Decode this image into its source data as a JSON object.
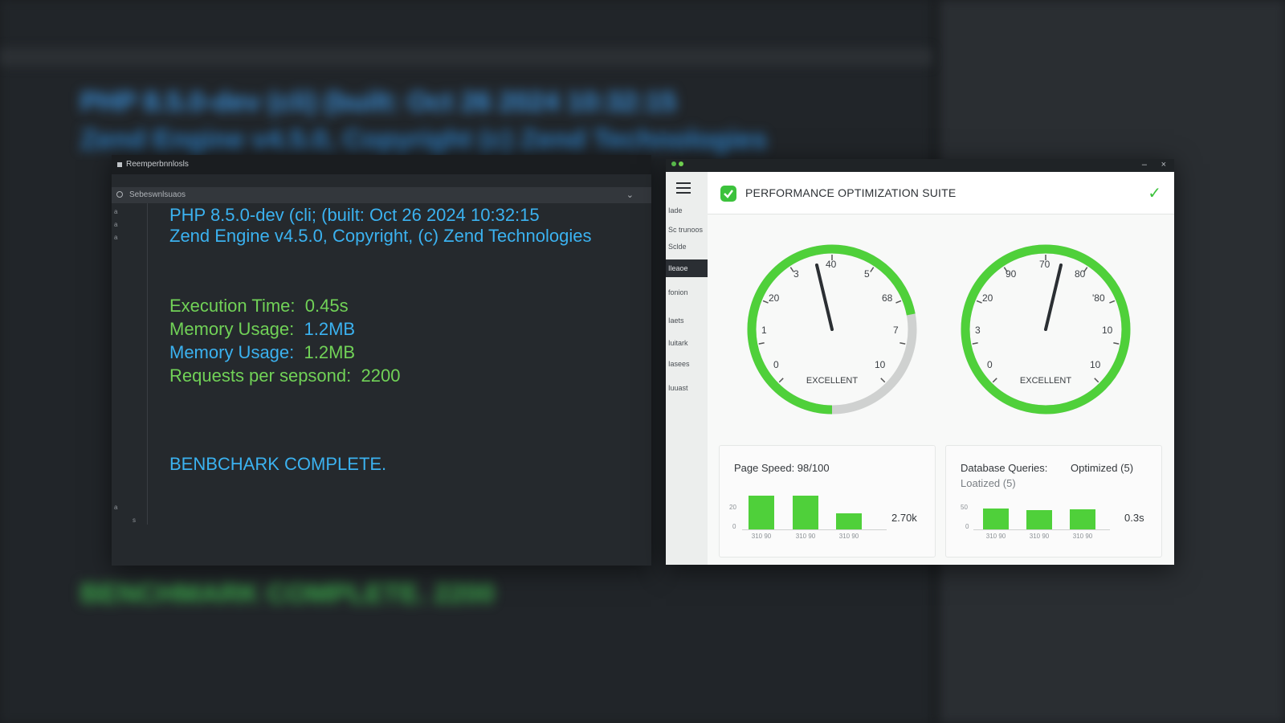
{
  "background": {
    "blurred_lines": [
      {
        "text": "PHP 8.5.0-dev (cli) (built: Oct 26 2024 10:32:15",
        "color": "#3a8fd8"
      },
      {
        "text": "Zend Engine v4.5.0, Copyright (c) Zend Technologies",
        "color": "#2d7fc4"
      },
      {
        "text": "BENCHMARK COMPLETE. 2200",
        "color": "#3ba84a"
      }
    ]
  },
  "terminal": {
    "window_title": "Reemperbnnlosls",
    "tab_label": "Sebeswnlsuaos",
    "tab_chevron": "⌄",
    "gutter": [
      "a",
      "a",
      "a",
      "a",
      "s"
    ],
    "lines": [
      {
        "text": "PHP 8.5.0-dev (cli; (built: Oct 26 2024 10:32:15",
        "color": "blue"
      },
      {
        "text": "Zend Engine v4.5.0, Copyright, (c) Zend Technologies",
        "color": "blue"
      },
      {
        "label": "Execution Time:",
        "value": "0.45s",
        "label_color": "green",
        "value_color": "green"
      },
      {
        "label": "Memory Usage:",
        "value": "1.2MB",
        "label_color": "green",
        "value_color": "blue"
      },
      {
        "label": "Memory Usage:",
        "value": "1.2MB",
        "label_color": "blue",
        "value_color": "green"
      },
      {
        "label": "Requests per sepsond:",
        "value": "2200",
        "label_color": "green",
        "value_color": "green"
      },
      {
        "text": "BENBCHARK COMPLETE.",
        "color": "blue"
      }
    ]
  },
  "app": {
    "title": "PERFORMANCE OPTIMIZATION SUITE",
    "header_check": "✓",
    "window_min": "–",
    "window_close": "×",
    "sidebar": [
      "Iade",
      "Sc trunoos",
      "Sclde",
      "Ileaoe",
      "fonion",
      "Iaets",
      "Iuitark",
      "Iasees",
      "Iuuast"
    ],
    "gauges": [
      {
        "ticks": [
          "3",
          "40",
          "5",
          "20",
          "68",
          "1",
          "7",
          "0",
          "10"
        ],
        "status": "EXCELLENT",
        "level": 0.72
      },
      {
        "ticks": [
          "90",
          "70",
          "80",
          "20",
          "'80",
          "3",
          "10",
          "0",
          "10"
        ],
        "status": "EXCELLENT",
        "level": 1.0
      }
    ],
    "cards": [
      {
        "title": "Page Speed: 98/100",
        "metric": "2.70k",
        "yticks": [
          "20",
          "0"
        ],
        "xticks": [
          "310 90",
          "310 90",
          "310 90"
        ],
        "values": [
          0.95,
          0.95,
          0.45
        ]
      },
      {
        "title": "Database Queries:",
        "title_right": "Optimized (5)",
        "subtitle": "Loatized (5)",
        "metric": "0.3s",
        "yticks": [
          "50",
          "0"
        ],
        "xticks": [
          "310 90",
          "310 90",
          "310 90"
        ],
        "values": [
          0.58,
          0.54,
          0.56
        ]
      }
    ]
  },
  "colors": {
    "accent_green": "#4fd03a",
    "terminal_blue": "#3bb2f0",
    "terminal_green": "#71d257"
  }
}
